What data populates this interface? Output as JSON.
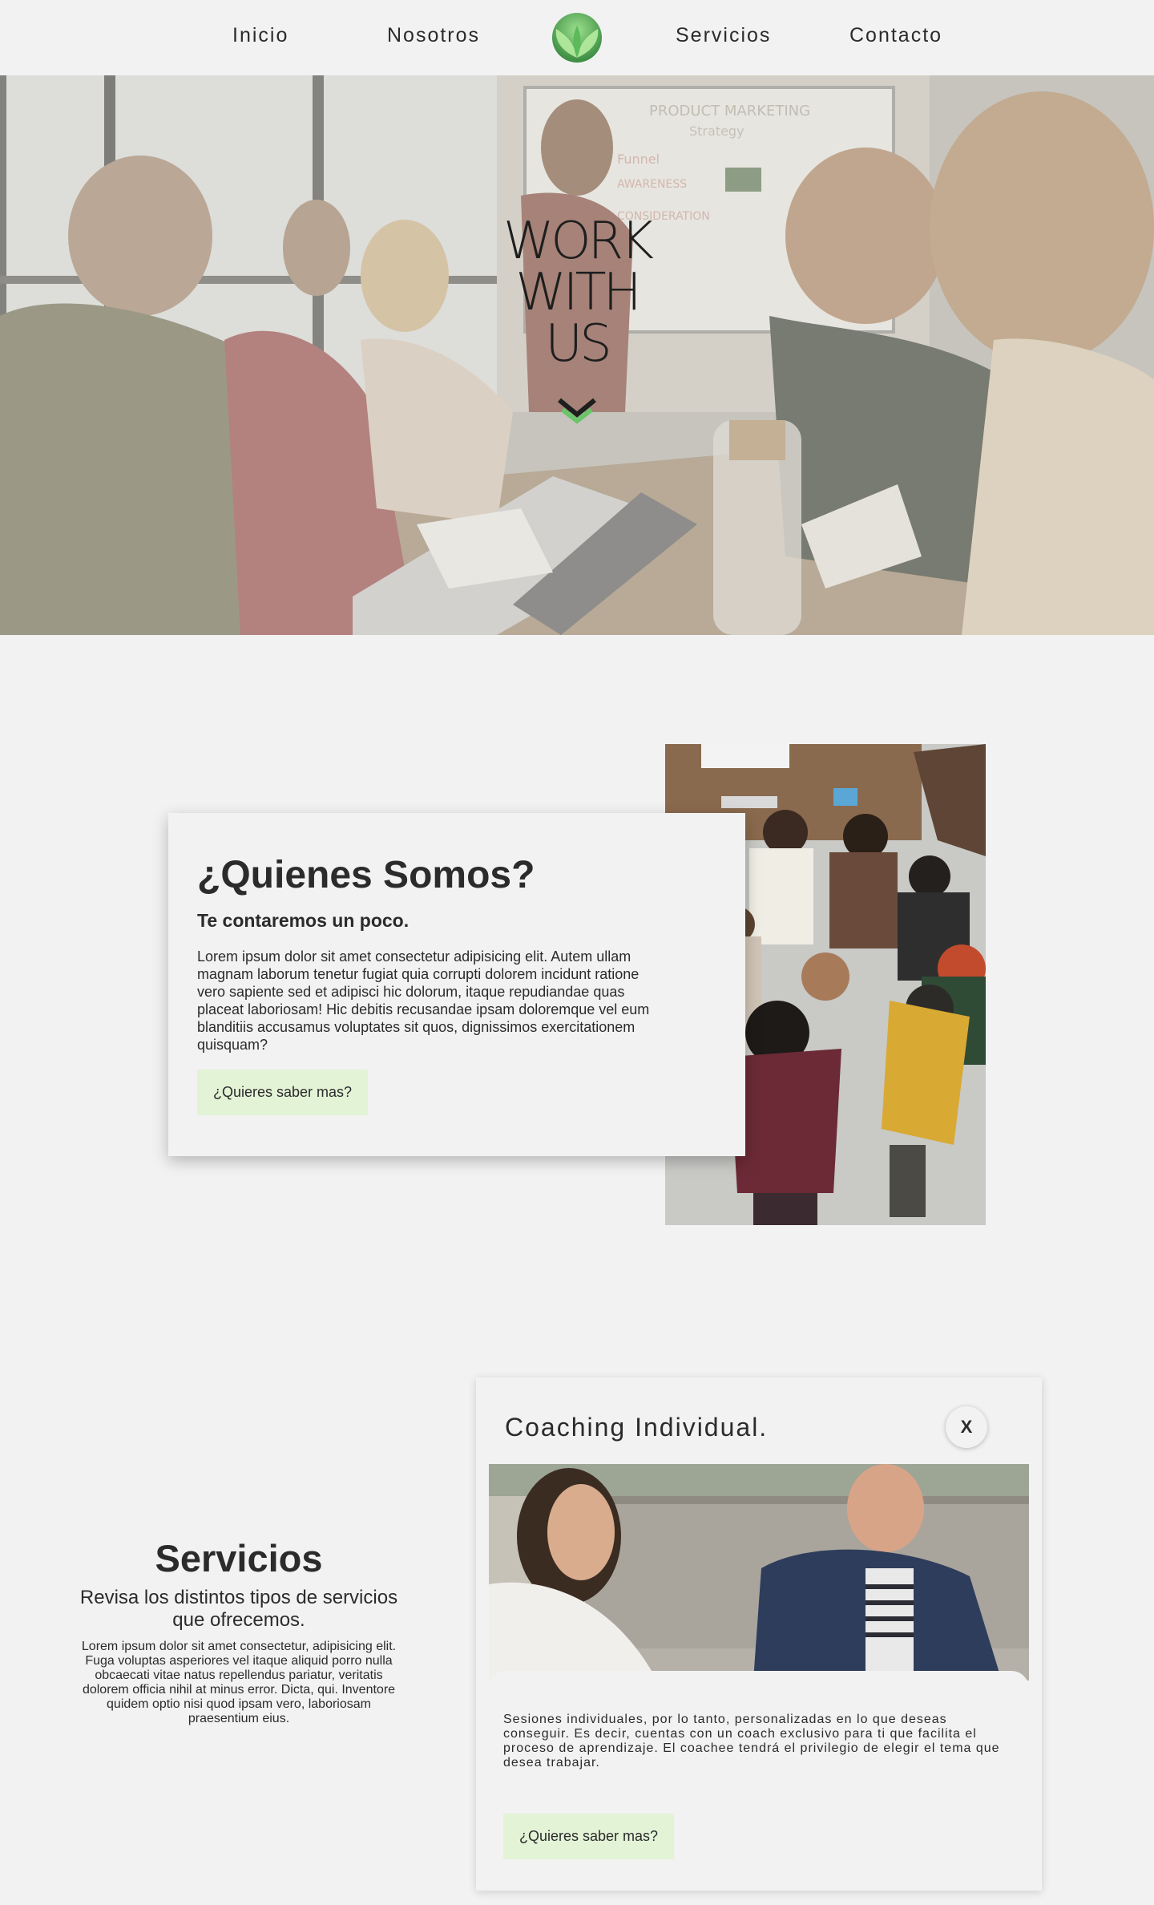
{
  "nav": {
    "items": [
      "Inicio",
      "Nosotros",
      "Servicios",
      "Contacto"
    ],
    "logo_icon": "leaf-logo-icon"
  },
  "hero": {
    "title": "WORK\nWITH\nUS",
    "scroll_icon": "chevron-down-icon"
  },
  "about": {
    "title": "¿Quienes Somos?",
    "subtitle": "Te contaremos un poco.",
    "text": "Lorem ipsum dolor sit amet consectetur adipisicing elit. Autem ullam magnam laborum tenetur fugiat quia corrupti dolorem incidunt ratione vero sapiente sed et adipisci hic dolorum, itaque repudiandae quas placeat laboriosam! Hic debitis recusandae ipsam doloremque vel eum blanditiis accusamus voluptates sit quos, dignissimos exercitationem quisquam?",
    "button": "¿Quieres saber mas?"
  },
  "services": {
    "title": "Servicios",
    "subtitle": "Revisa los distintos tipos de servicios que ofrecemos.",
    "text": "Lorem ipsum dolor sit amet consectetur, adipisicing elit. Fuga voluptas asperiores vel itaque aliquid porro nulla obcaecati vitae natus repellendus pariatur, veritatis dolorem officia nihil at minus error. Dicta, qui. Inventore quidem optio nisi quod ipsam vero, laboriosam praesentium eius."
  },
  "coach_card": {
    "title": "Coaching Individual.",
    "close": "X",
    "text": "Sesiones individuales, por lo tanto, personalizadas en lo que deseas conseguir. Es decir, cuentas con un coach exclusivo para ti que facilita el proceso de aprendizaje. El coachee tendrá el privilegio de elegir el tema que desea trabajar.",
    "button": "¿Quieres saber mas?"
  },
  "colors": {
    "background": "#f2f2f2",
    "text": "#2b2b2b",
    "button_bg": "#e3f3d6",
    "accent_green": "#6cc46a"
  }
}
